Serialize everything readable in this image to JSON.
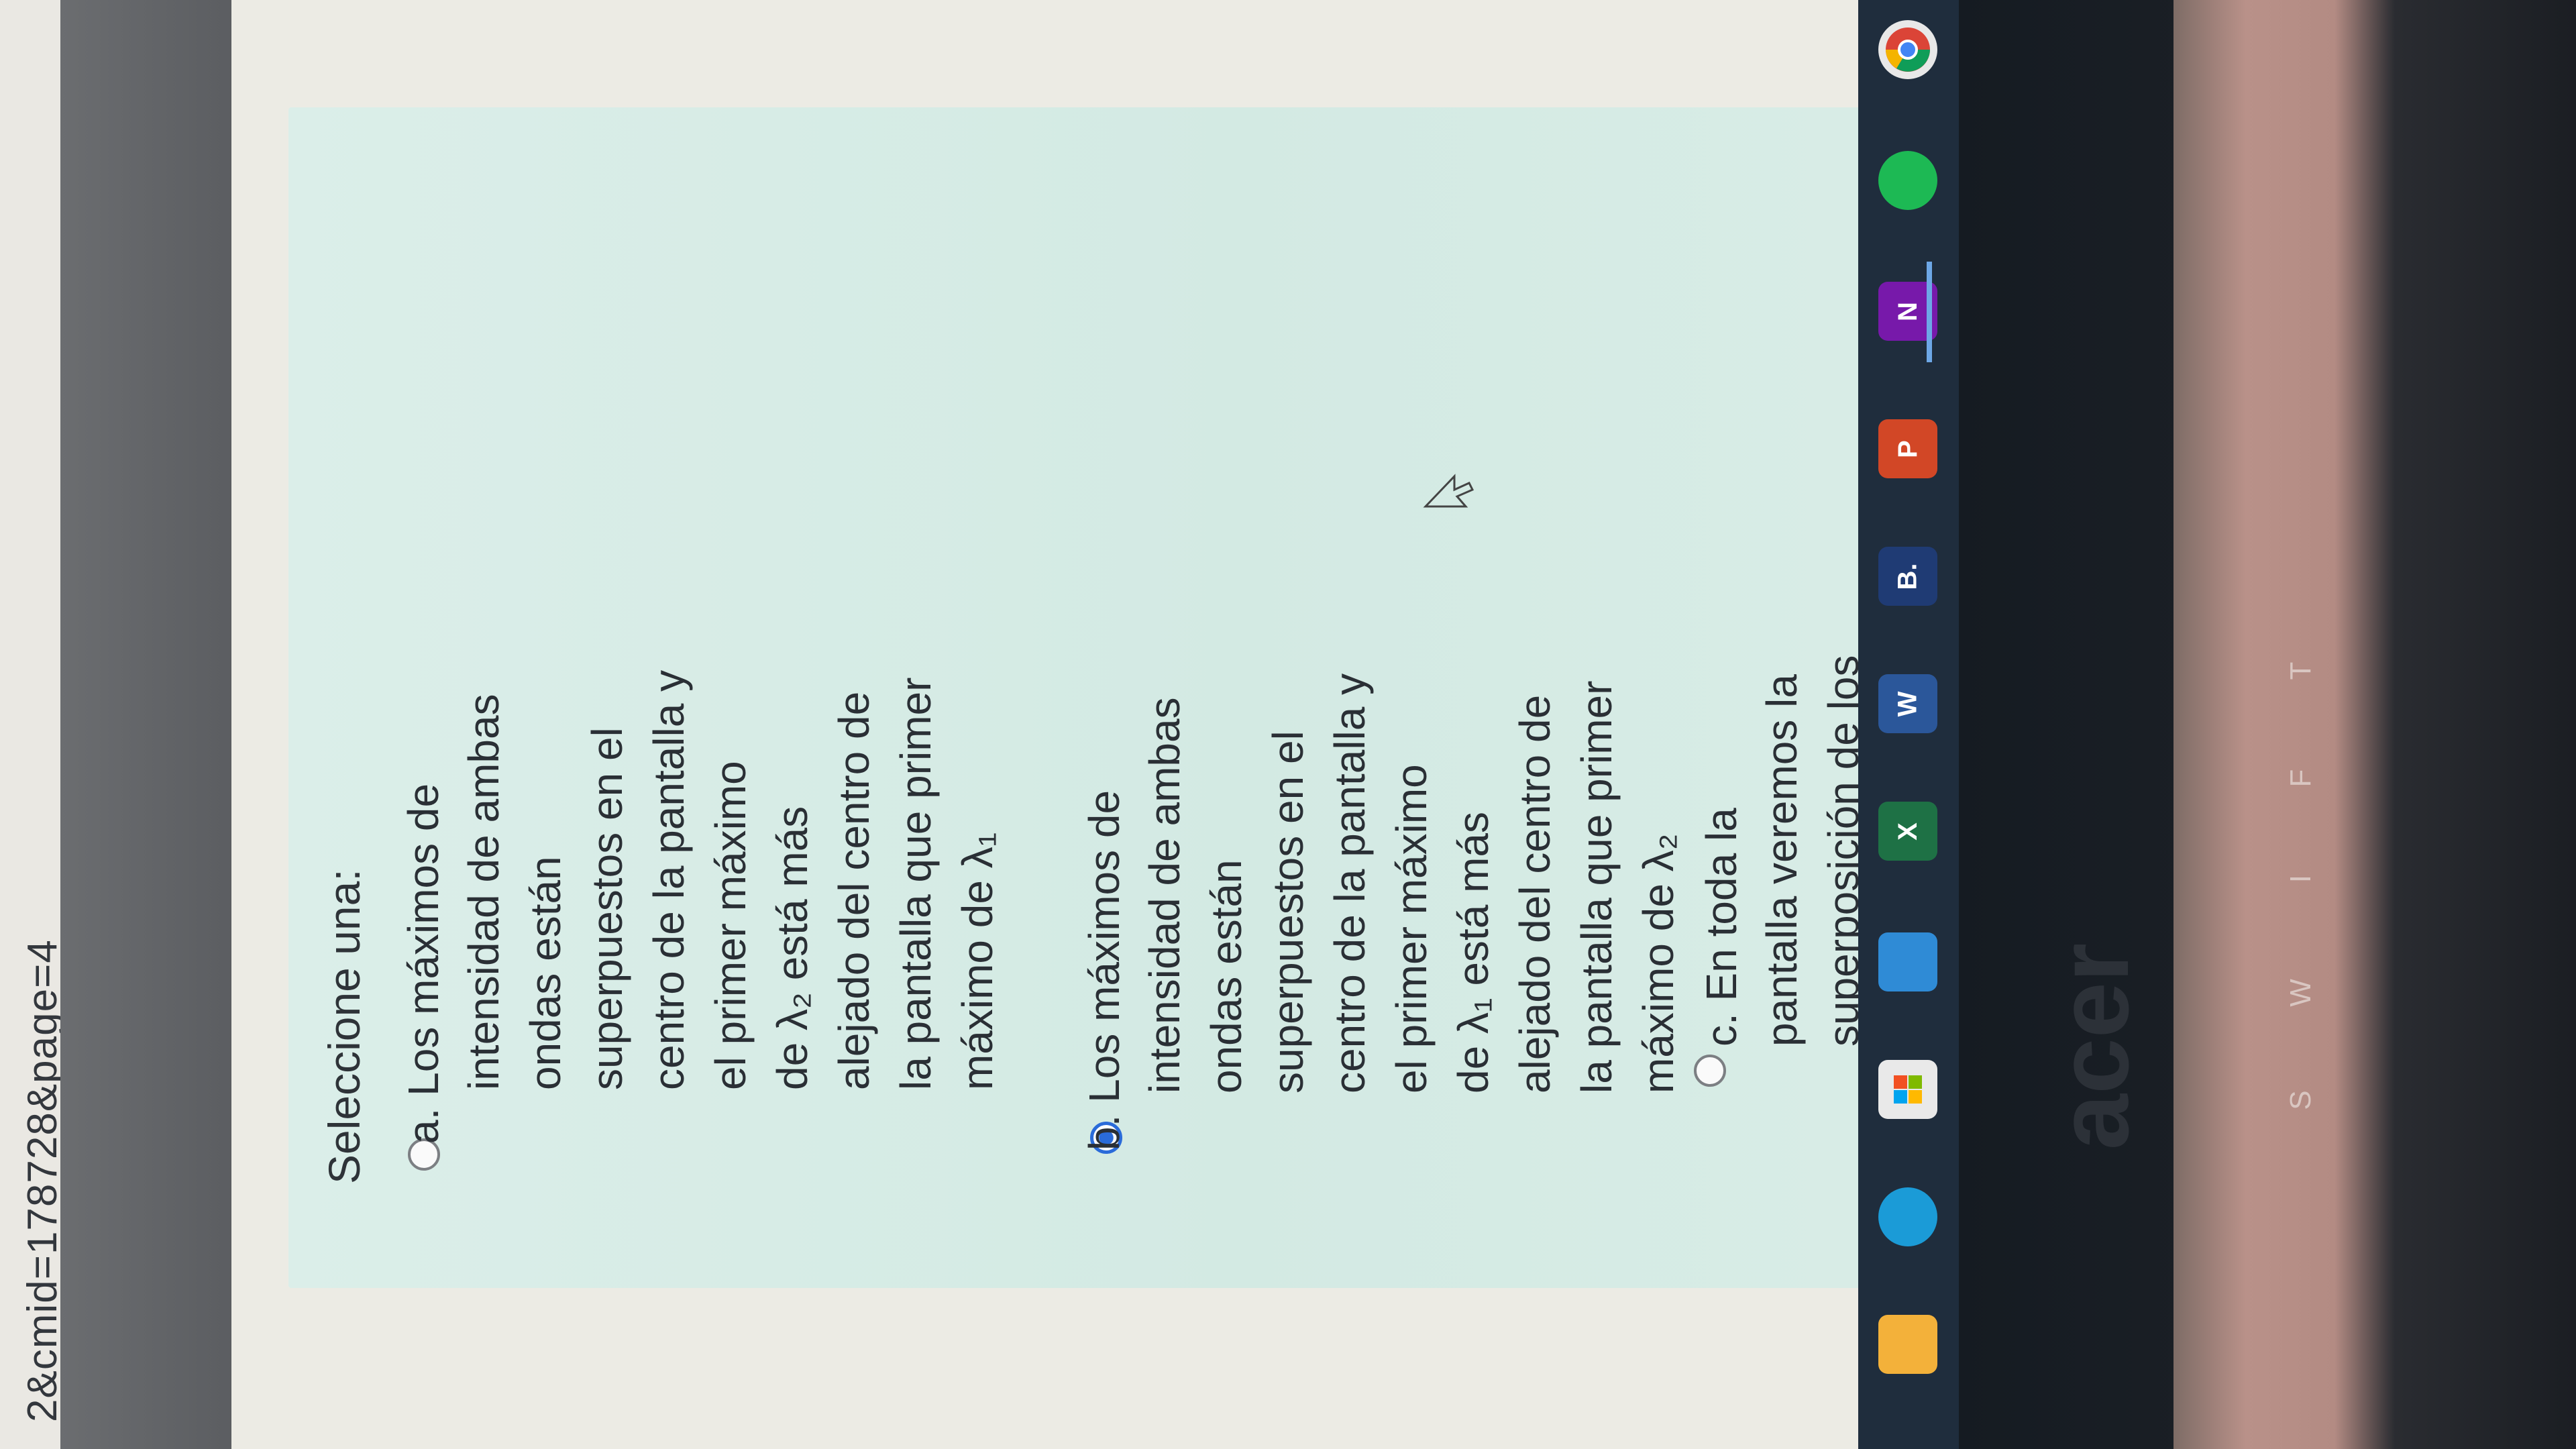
{
  "browser": {
    "url_fragment": "2&cmid=178728&page=4"
  },
  "question": {
    "prompt": "Seleccione una:",
    "selected": "b",
    "options": [
      {
        "key": "a",
        "lines": [
          "a. Los máximos de",
          "intensidad de ambas",
          "ondas están",
          "superpuestos en el",
          "centro de la pantalla y",
          "el primer máximo",
          "de λ₂ está más",
          "alejado del centro de",
          "la pantalla que primer",
          "máximo de λ₁"
        ]
      },
      {
        "key": "b",
        "lines": [
          "b. Los máximos de",
          "intensidad de ambas",
          "ondas están",
          "superpuestos en el",
          "centro de la pantalla y",
          "el primer máximo",
          "de λ₁ está más",
          "alejado del centro de",
          "la pantalla que primer",
          "máximo de λ₂"
        ]
      },
      {
        "key": "c",
        "lines": [
          "c. En toda la",
          "pantalla veremos la",
          "superposición de los"
        ]
      }
    ]
  },
  "taskbar": {
    "apps": [
      {
        "name": "file-explorer",
        "label": "",
        "color": "#f3b13a"
      },
      {
        "name": "edge",
        "label": "",
        "color": "#1b9bd7"
      },
      {
        "name": "microsoft-store",
        "label": "",
        "color": "#e9e9e9"
      },
      {
        "name": "mail",
        "label": "",
        "color": "#2f8bd6"
      },
      {
        "name": "excel",
        "label": "X",
        "color": "#1e7145"
      },
      {
        "name": "word",
        "label": "W",
        "color": "#2b579a"
      },
      {
        "name": "app-b",
        "label": "B.",
        "color": "#1f3b74"
      },
      {
        "name": "powerpoint",
        "label": "P",
        "color": "#d24726"
      },
      {
        "name": "onenote",
        "label": "N",
        "color": "#7719aa"
      },
      {
        "name": "spotify",
        "label": "",
        "color": "#1db954"
      },
      {
        "name": "chrome",
        "label": "",
        "color": "#e8e8e8"
      }
    ]
  },
  "device": {
    "brand": "acer",
    "keys": [
      "S",
      "W",
      "I",
      "F",
      "T"
    ]
  }
}
